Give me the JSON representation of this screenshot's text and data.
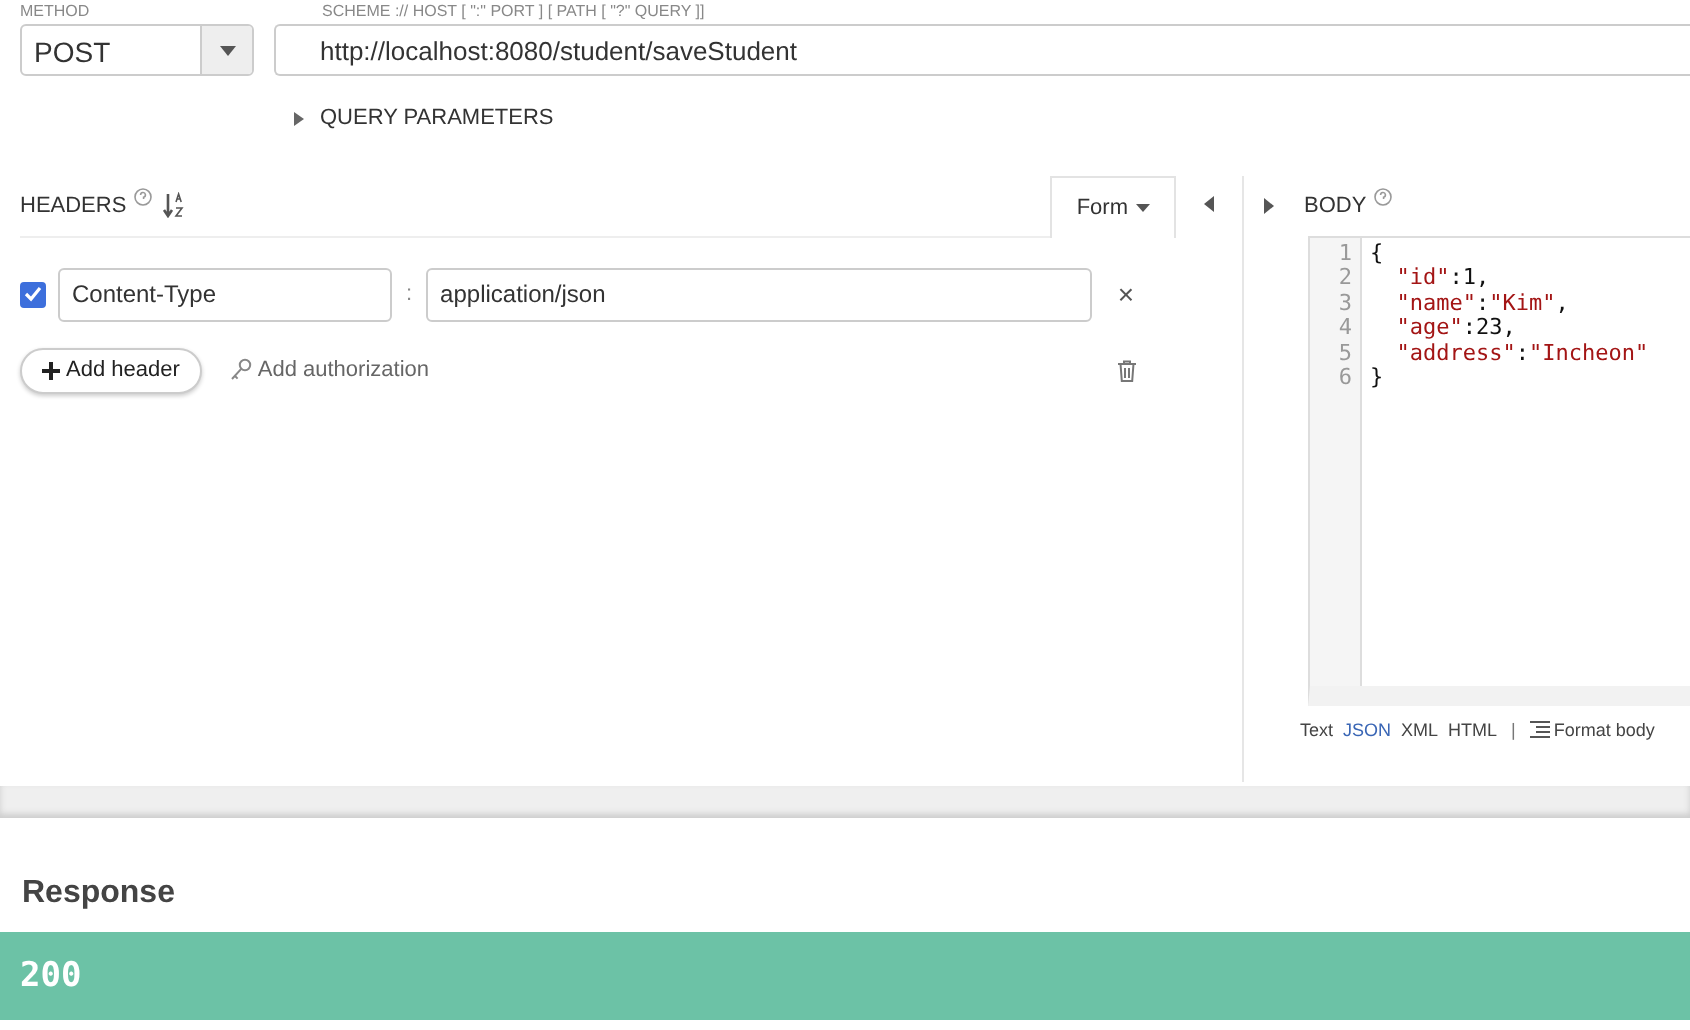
{
  "request": {
    "method_label": "METHOD",
    "method": "POST",
    "url_label": "SCHEME :// HOST [ \":\" PORT ] [ PATH [ \"?\" QUERY ]]",
    "url": "http://localhost:8080/student/saveStudent",
    "query_parameters": "QUERY PARAMETERS"
  },
  "headers": {
    "title": "HEADERS",
    "mode": "Form",
    "rows": [
      {
        "checked": true,
        "name": "Content-Type",
        "value": "application/json",
        "separator": ":",
        "remove": "×"
      }
    ],
    "add_header": "Add header",
    "add_authorization": "Add authorization"
  },
  "body": {
    "title": "BODY",
    "lines": [
      {
        "number": "1",
        "code": "{"
      },
      {
        "number": "2",
        "code": "  \"id\":1,"
      },
      {
        "number": "3",
        "code": "  \"name\":\"Kim\","
      },
      {
        "number": "4",
        "code": "  \"age\":23,"
      },
      {
        "number": "5",
        "code": "  \"address\":\"Incheon\""
      },
      {
        "number": "6",
        "code": "}"
      }
    ],
    "formats": [
      {
        "label": "Text",
        "selected": false
      },
      {
        "label": "JSON",
        "selected": true
      },
      {
        "label": "XML",
        "selected": false
      },
      {
        "label": "HTML",
        "selected": false
      }
    ],
    "separator": "|",
    "format_body": "Format body"
  },
  "response": {
    "title": "Response",
    "status": "200"
  }
}
